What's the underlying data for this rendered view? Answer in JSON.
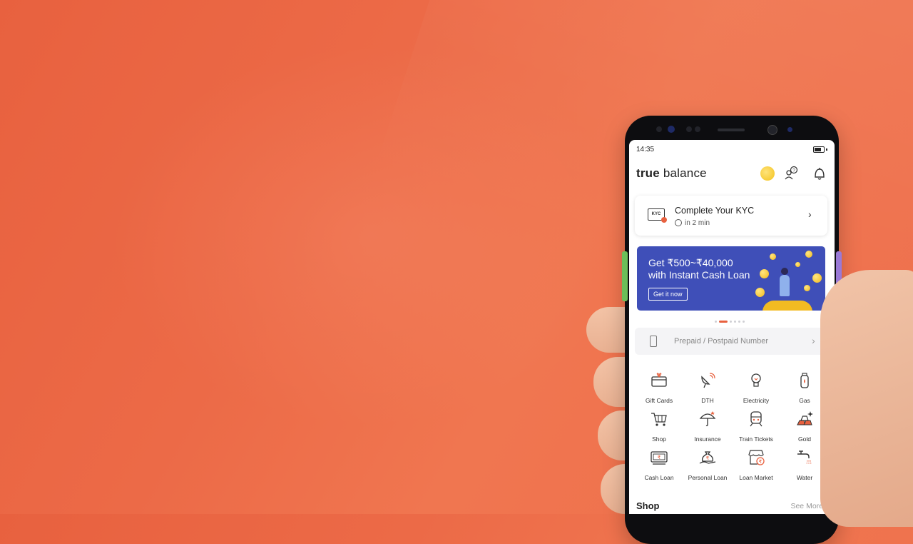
{
  "status_bar": {
    "time": "14:35"
  },
  "header": {
    "logo_bold": "true",
    "logo_light": " balance"
  },
  "kyc": {
    "title": "Complete Your KYC",
    "subtitle": "in 2 min",
    "badge": "KYC"
  },
  "banner": {
    "line1": "Get ₹500~₹40,000",
    "line2": "with Instant Cash Loan",
    "button": "Get it now"
  },
  "recharge": {
    "placeholder": "Prepaid / Postpaid Number"
  },
  "services": [
    {
      "label": "Gift Cards",
      "icon": "gift-card-icon"
    },
    {
      "label": "DTH",
      "icon": "satellite-dish-icon"
    },
    {
      "label": "Electricity",
      "icon": "bulb-icon"
    },
    {
      "label": "Gas",
      "icon": "gas-cylinder-icon"
    },
    {
      "label": "Shop",
      "icon": "cart-icon"
    },
    {
      "label": "Insurance",
      "icon": "umbrella-icon"
    },
    {
      "label": "Train Tickets",
      "icon": "train-icon"
    },
    {
      "label": "Gold",
      "icon": "gold-bars-icon"
    },
    {
      "label": "Cash Loan",
      "icon": "cash-icon"
    },
    {
      "label": "Personal Loan",
      "icon": "money-bag-icon"
    },
    {
      "label": "Loan Market",
      "icon": "store-icon"
    },
    {
      "label": "Water",
      "icon": "tap-icon"
    }
  ],
  "shop_section": {
    "title": "Shop",
    "see_more": "See More"
  },
  "colors": {
    "background": "#ec6a47",
    "banner": "#3f4fb8",
    "accent": "#e8613f",
    "coin": "#f3c21b"
  }
}
